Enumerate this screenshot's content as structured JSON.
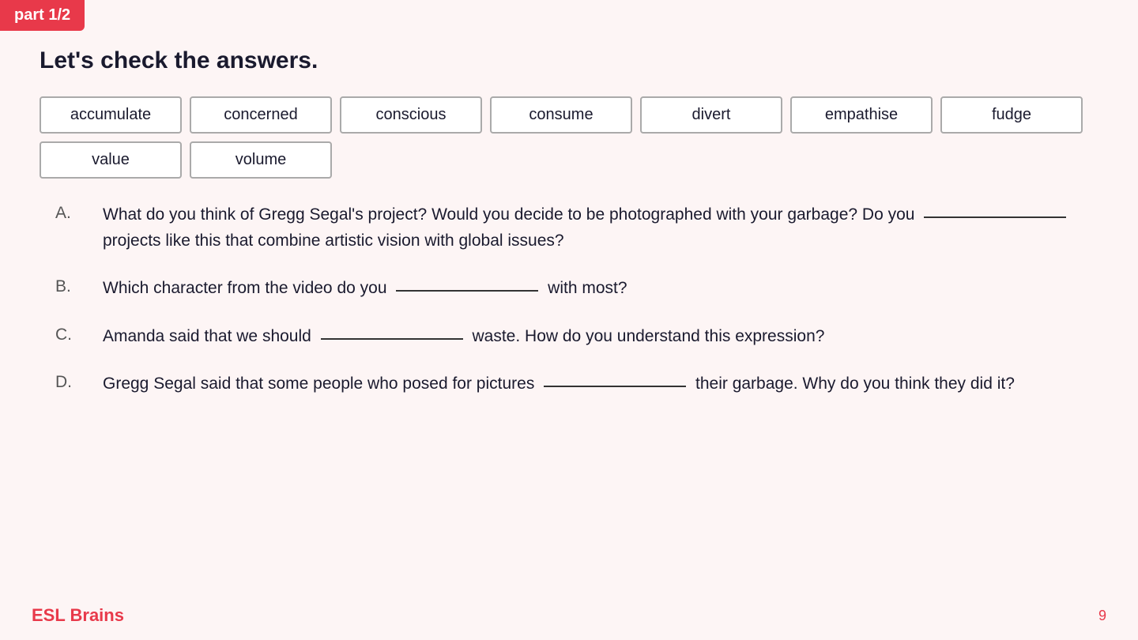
{
  "badge": {
    "label": "part 1/2"
  },
  "header": {
    "title": "Let's check the answers."
  },
  "word_bank": {
    "words": [
      "accumulate",
      "concerned",
      "conscious",
      "consume",
      "divert",
      "empathise",
      "fudge",
      "value",
      "volume"
    ]
  },
  "questions": [
    {
      "letter": "A.",
      "parts": [
        "What do you think of Gregg Segal's project? Would you decide to be photographed with your garbage? Do you",
        "projects like this that combine artistic vision with global issues?"
      ]
    },
    {
      "letter": "B.",
      "parts": [
        "Which character from the video do you",
        "with most?"
      ]
    },
    {
      "letter": "C.",
      "parts": [
        "Amanda said that we should",
        "waste. How do you understand this expression?"
      ]
    },
    {
      "letter": "D.",
      "parts": [
        "Gregg Segal said that some people who posed for pictures",
        "their garbage. Why do you think they did it?"
      ]
    }
  ],
  "footer": {
    "brand": "ESL Brains",
    "page": "9"
  }
}
